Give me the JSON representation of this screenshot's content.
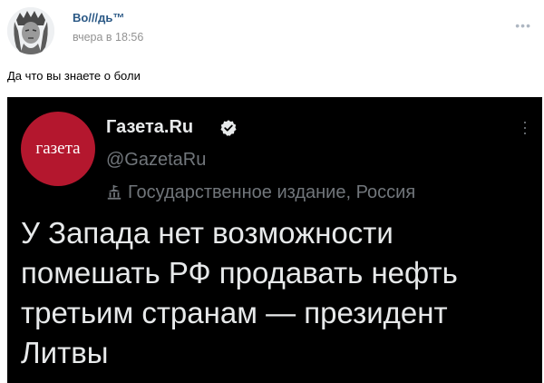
{
  "post": {
    "author": "Во///дь™",
    "time": "вчера в 18:56",
    "more_icon": "more-horizontal-icon",
    "text": "Да что вы знаете о боли"
  },
  "tweet": {
    "logo_text": "газета",
    "name": "Газета.Ru",
    "verified_icon": "verified-badge-icon",
    "handle": "@GazetaRu",
    "gov_icon": "government-building-icon",
    "gov_label": "Государственное издание, Россия",
    "body": "У Запада нет возможности помешать РФ продавать нефть третьим странам — президент Литвы"
  },
  "colors": {
    "link": "#2a5885",
    "muted": "#939393",
    "tweet_bg": "#000000",
    "tweet_text": "#e7e9ea",
    "tweet_muted": "#71767b",
    "logo_red": "#b4172e"
  }
}
